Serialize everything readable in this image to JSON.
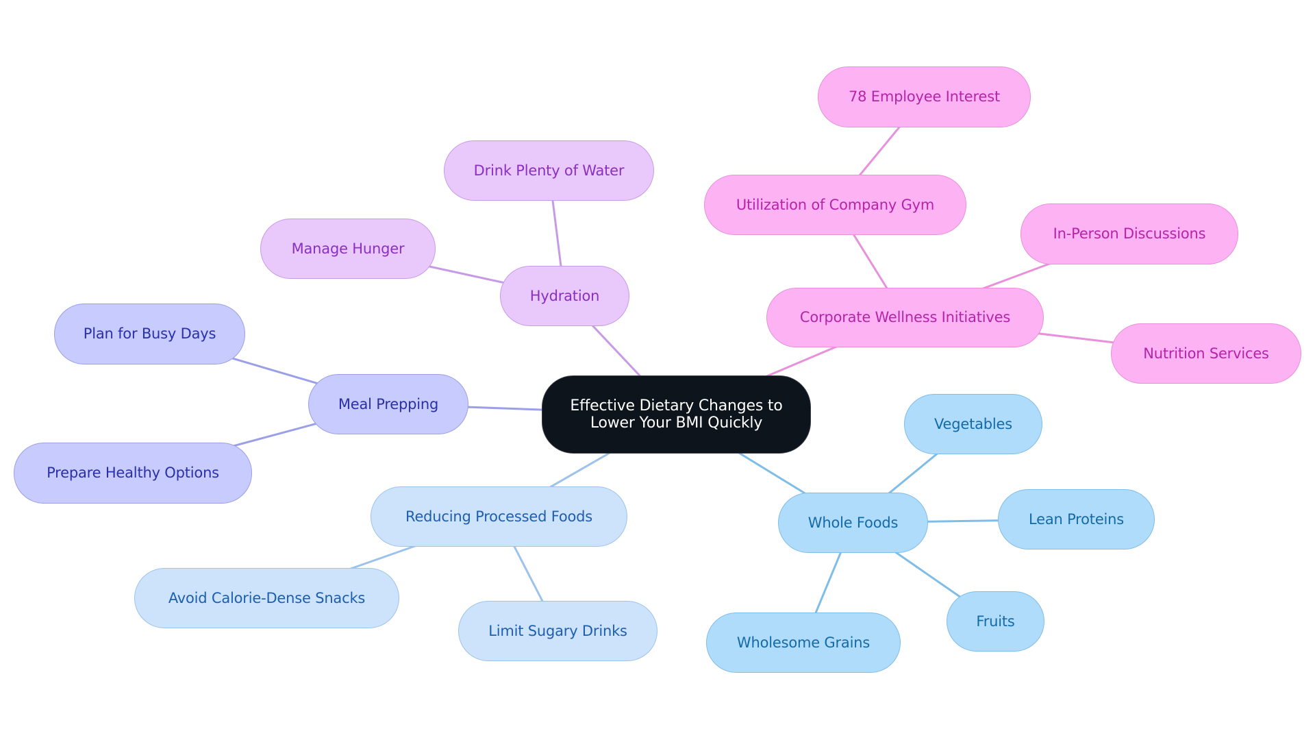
{
  "title": "Effective Dietary Changes to Lower Your BMI Quickly",
  "colors": {
    "root_fill": "#0d141b",
    "hydration_branch": "#c79ae6",
    "corporate_branch": "#e890db",
    "meal_prep_branch": "#9a9fe8",
    "processed_branch": "#9dc2ec",
    "whole_foods_branch": "#7fbde9"
  },
  "nodes": {
    "root": {
      "label": "Effective Dietary Changes to Lower Your BMI Quickly"
    },
    "hydration": {
      "label": "Hydration"
    },
    "drink_water": {
      "label": "Drink Plenty of Water"
    },
    "manage_hunger": {
      "label": "Manage Hunger"
    },
    "corporate": {
      "label": "Corporate Wellness Initiatives"
    },
    "gym": {
      "label": "Utilization of Company Gym"
    },
    "employee_interest": {
      "label": "78 Employee Interest"
    },
    "in_person": {
      "label": "In-Person Discussions"
    },
    "nutrition_services": {
      "label": "Nutrition Services"
    },
    "meal_prepping": {
      "label": "Meal Prepping"
    },
    "busy_days": {
      "label": "Plan for Busy Days"
    },
    "healthy_options": {
      "label": "Prepare Healthy Options"
    },
    "processed": {
      "label": "Reducing Processed Foods"
    },
    "avoid_snacks": {
      "label": "Avoid Calorie-Dense Snacks"
    },
    "sugary_drinks": {
      "label": "Limit Sugary Drinks"
    },
    "whole_foods": {
      "label": "Whole Foods"
    },
    "vegetables": {
      "label": "Vegetables"
    },
    "lean_proteins": {
      "label": "Lean Proteins"
    },
    "fruits": {
      "label": "Fruits"
    },
    "grains": {
      "label": "Wholesome Grains"
    }
  },
  "edges": [
    [
      "root",
      "hydration",
      "hydration_branch"
    ],
    [
      "hydration",
      "drink_water",
      "hydration_branch"
    ],
    [
      "hydration",
      "manage_hunger",
      "hydration_branch"
    ],
    [
      "root",
      "corporate",
      "corporate_branch"
    ],
    [
      "corporate",
      "gym",
      "corporate_branch"
    ],
    [
      "gym",
      "employee_interest",
      "corporate_branch"
    ],
    [
      "corporate",
      "in_person",
      "corporate_branch"
    ],
    [
      "corporate",
      "nutrition_services",
      "corporate_branch"
    ],
    [
      "root",
      "meal_prepping",
      "meal_prep_branch"
    ],
    [
      "meal_prepping",
      "busy_days",
      "meal_prep_branch"
    ],
    [
      "meal_prepping",
      "healthy_options",
      "meal_prep_branch"
    ],
    [
      "root",
      "processed",
      "processed_branch"
    ],
    [
      "processed",
      "avoid_snacks",
      "processed_branch"
    ],
    [
      "processed",
      "sugary_drinks",
      "processed_branch"
    ],
    [
      "root",
      "whole_foods",
      "whole_foods_branch"
    ],
    [
      "whole_foods",
      "vegetables",
      "whole_foods_branch"
    ],
    [
      "whole_foods",
      "lean_proteins",
      "whole_foods_branch"
    ],
    [
      "whole_foods",
      "fruits",
      "whole_foods_branch"
    ],
    [
      "whole_foods",
      "grains",
      "whole_foods_branch"
    ]
  ]
}
